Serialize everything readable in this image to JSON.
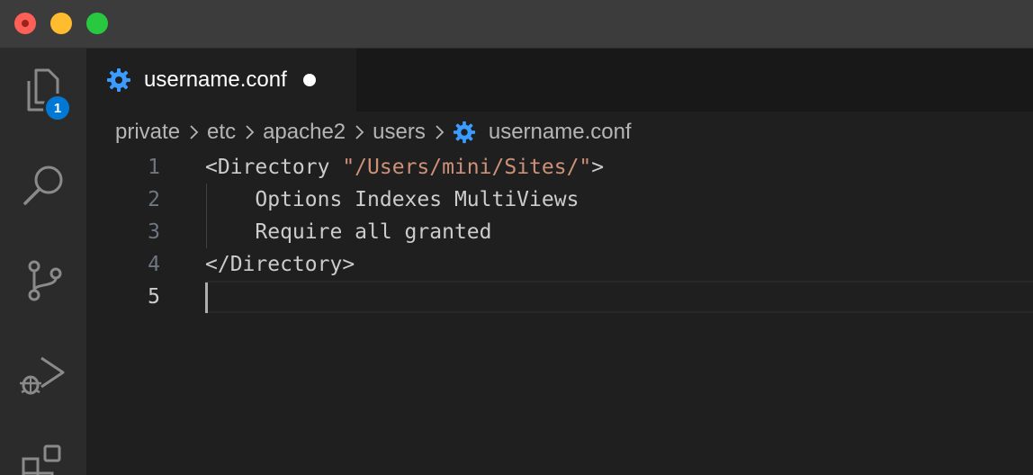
{
  "window": {
    "controls": [
      "close",
      "minimize",
      "zoom"
    ]
  },
  "activity_bar": {
    "items": [
      {
        "name": "explorer",
        "icon": "files-icon",
        "badge": "1"
      },
      {
        "name": "search",
        "icon": "search-icon"
      },
      {
        "name": "source-control",
        "icon": "source-control-icon"
      },
      {
        "name": "run-debug",
        "icon": "run-debug-icon"
      },
      {
        "name": "extensions",
        "icon": "extensions-icon"
      }
    ]
  },
  "tab": {
    "label": "username.conf",
    "icon": "gear-icon",
    "dirty": true
  },
  "breadcrumb": {
    "items": [
      "private",
      "etc",
      "apache2",
      "users",
      "username.conf"
    ],
    "file_icon": "gear-icon"
  },
  "editor": {
    "lines": [
      {
        "number": "1",
        "parts": [
          {
            "text": "<Directory ",
            "kind": "plain"
          },
          {
            "text": "\"/Users/mini/Sites/\"",
            "kind": "string"
          },
          {
            "text": ">",
            "kind": "plain"
          }
        ]
      },
      {
        "number": "2",
        "parts": [
          {
            "text": "    Options Indexes MultiViews",
            "kind": "plain"
          }
        ]
      },
      {
        "number": "3",
        "parts": [
          {
            "text": "    Require all granted",
            "kind": "plain"
          }
        ]
      },
      {
        "number": "4",
        "parts": [
          {
            "text": "</Directory>",
            "kind": "plain"
          }
        ]
      },
      {
        "number": "5",
        "parts": []
      }
    ],
    "current_line": "5"
  },
  "colors": {
    "accent": "#0078d4",
    "gear": "#3b9cff",
    "string": "#ce9178"
  }
}
